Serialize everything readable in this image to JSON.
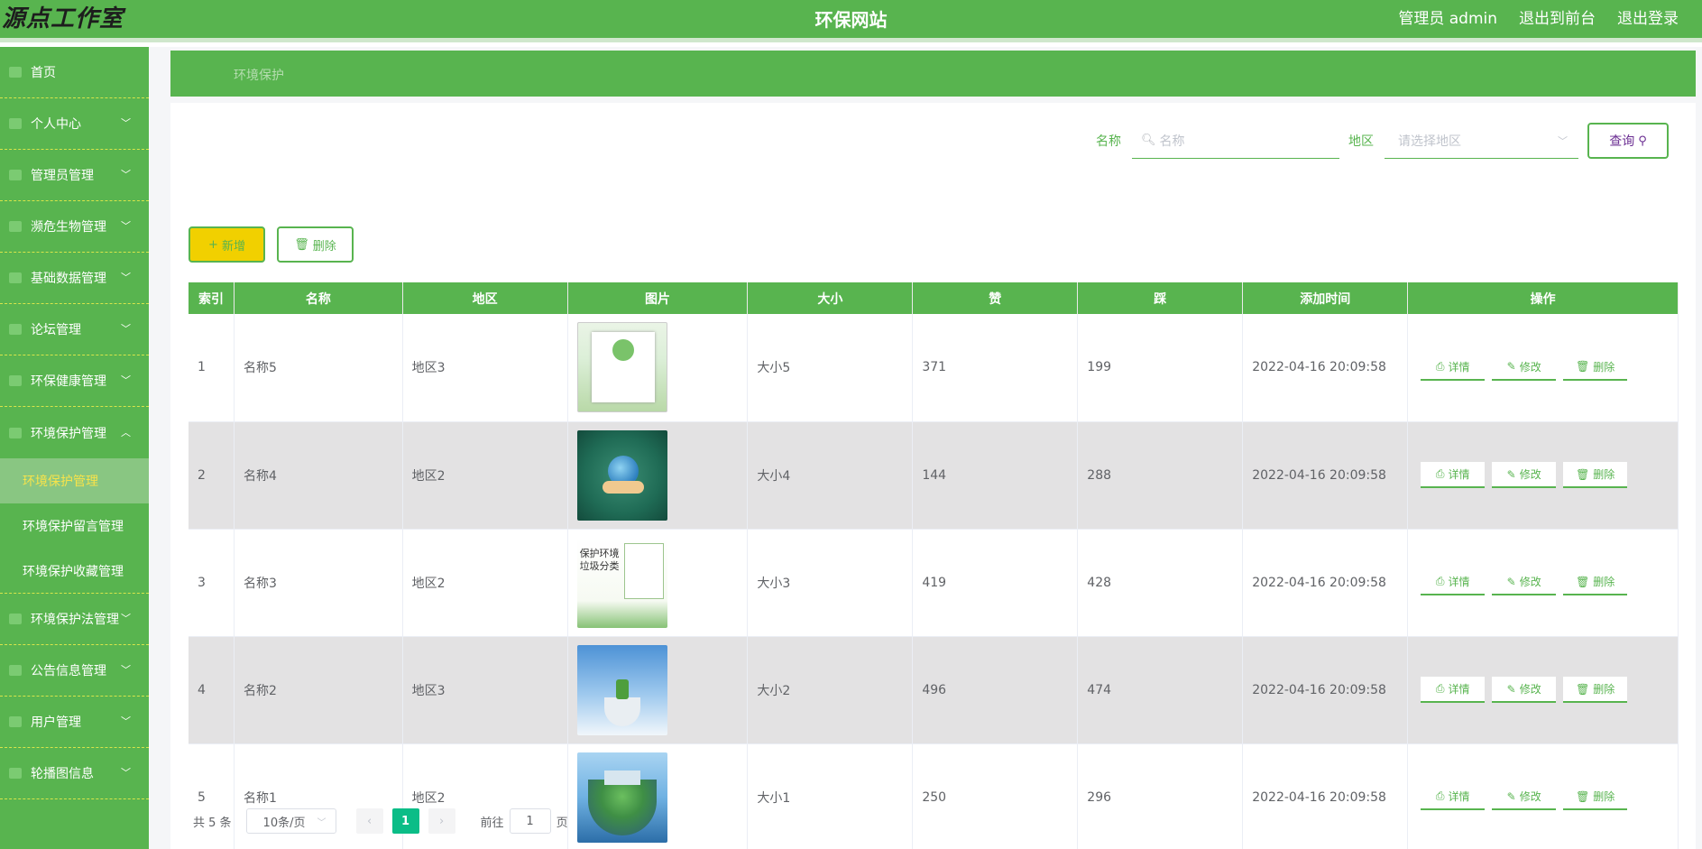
{
  "header": {
    "brand": "源点工作室",
    "title": "环保网站",
    "admin_label": "管理员 admin",
    "to_frontend": "退出到前台",
    "logout": "退出登录"
  },
  "sidebar": {
    "items": [
      {
        "label": "首页",
        "icon": "home-icon",
        "has_children": false
      },
      {
        "label": "个人中心",
        "icon": "user-icon",
        "has_children": true
      },
      {
        "label": "管理员管理",
        "icon": "admin-icon",
        "has_children": true
      },
      {
        "label": "濒危生物管理",
        "icon": "grid-icon",
        "has_children": true
      },
      {
        "label": "基础数据管理",
        "icon": "data-icon",
        "has_children": true
      },
      {
        "label": "论坛管理",
        "icon": "forum-icon",
        "has_children": true
      },
      {
        "label": "环保健康管理",
        "icon": "list-icon",
        "has_children": true
      },
      {
        "label": "环境保护管理",
        "icon": "list-icon",
        "has_children": true,
        "expanded": true
      }
    ],
    "sub_items": [
      "环境保护管理",
      "环境保护留言管理",
      "环境保护收藏管理"
    ],
    "items_after": [
      {
        "label": "环境保护法管理",
        "icon": "law-icon",
        "has_children": true
      },
      {
        "label": "公告信息管理",
        "icon": "notice-icon",
        "has_children": true
      },
      {
        "label": "用户管理",
        "icon": "users-icon",
        "has_children": true
      },
      {
        "label": "轮播图信息",
        "icon": "carousel-icon",
        "has_children": true
      }
    ]
  },
  "breadcrumb": "环境保护",
  "search": {
    "name_label": "名称",
    "name_placeholder": "名称",
    "region_label": "地区",
    "region_placeholder": "请选择地区",
    "query_label": "查询"
  },
  "actions": {
    "add_label": "新增",
    "delete_label": "删除"
  },
  "table": {
    "columns": [
      "索引",
      "名称",
      "地区",
      "图片",
      "大小",
      "赞",
      "踩",
      "添加时间",
      "操作"
    ],
    "rows": [
      {
        "index": "1",
        "name": "名称5",
        "region": "地区3",
        "size": "大小5",
        "likes": "371",
        "dislikes": "199",
        "time": "2022-04-16 20:09:58"
      },
      {
        "index": "2",
        "name": "名称4",
        "region": "地区2",
        "size": "大小4",
        "likes": "144",
        "dislikes": "288",
        "time": "2022-04-16 20:09:58"
      },
      {
        "index": "3",
        "name": "名称3",
        "region": "地区2",
        "size": "大小3",
        "likes": "419",
        "dislikes": "428",
        "time": "2022-04-16 20:09:58"
      },
      {
        "index": "4",
        "name": "名称2",
        "region": "地区3",
        "size": "大小2",
        "likes": "496",
        "dislikes": "474",
        "time": "2022-04-16 20:09:58"
      },
      {
        "index": "5",
        "name": "名称1",
        "region": "地区2",
        "size": "大小1",
        "likes": "250",
        "dislikes": "296",
        "time": "2022-04-16 20:09:58"
      }
    ],
    "row_actions": {
      "detail": "详情",
      "edit": "修改",
      "delete": "删除"
    },
    "thumb3_text": "保护环境\n垃圾分类"
  },
  "pagination": {
    "total": "共 5 条",
    "page_size": "10条/页",
    "current_page": "1",
    "goto_prefix": "前往",
    "goto_value": "1",
    "goto_suffix": "页"
  },
  "colors": {
    "primary": "#58b44f",
    "add_button": "#f1d000",
    "active_submenu_text": "#f7e34a",
    "page_active": "#0bbd87"
  }
}
